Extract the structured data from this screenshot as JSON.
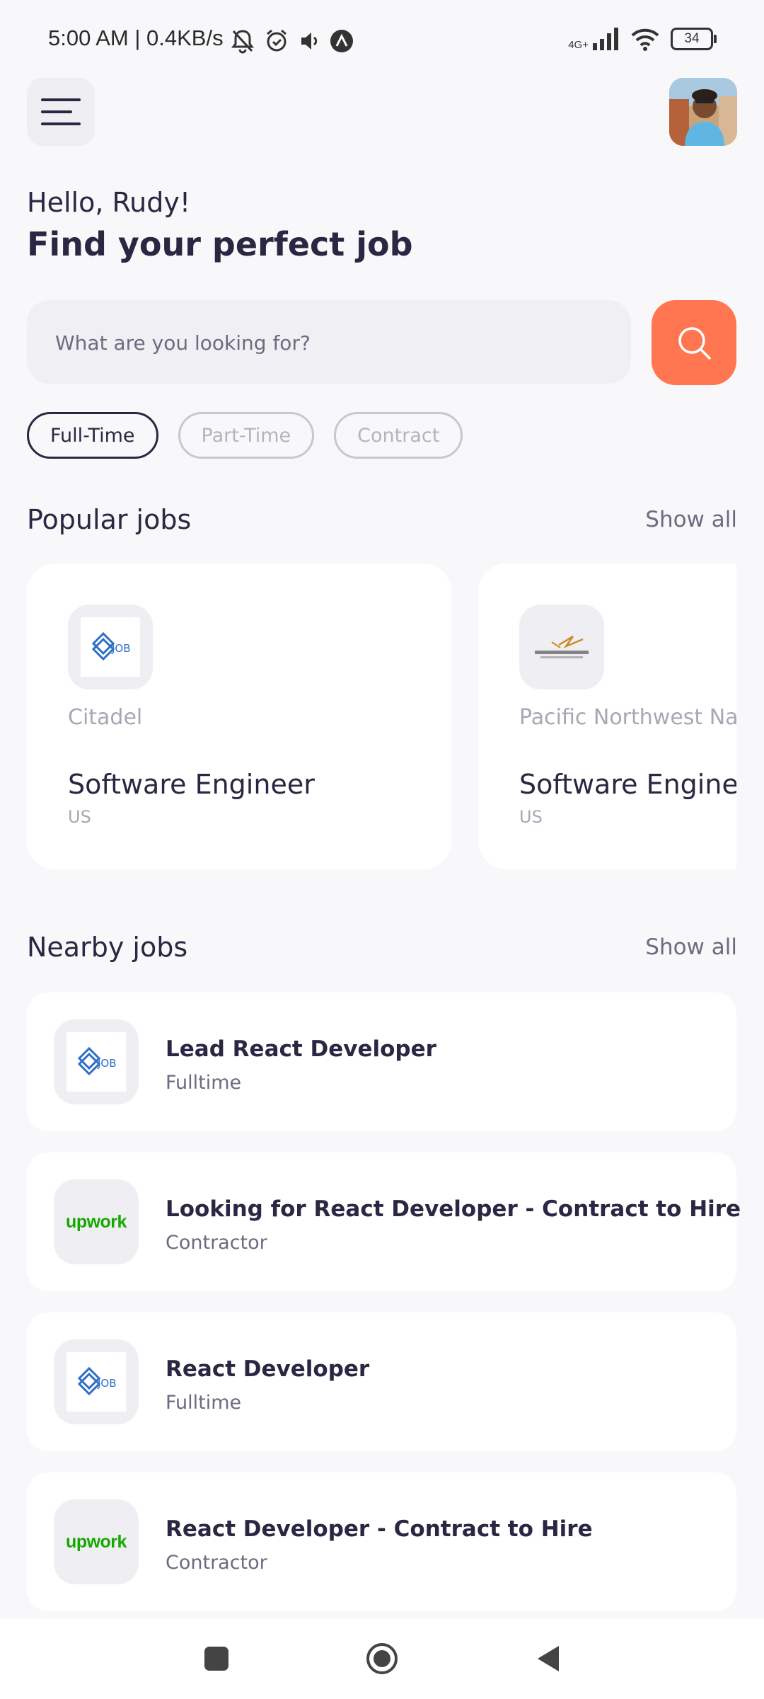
{
  "status_bar": {
    "time_and_speed": "5:00 AM | 0.4KB/s",
    "network": "4G+",
    "battery": "34"
  },
  "header": {
    "greeting": "Hello, Rudy!",
    "title": "Find your perfect job"
  },
  "search": {
    "placeholder": "What are you looking for?"
  },
  "filters": [
    "Full-Time",
    "Part-Time",
    "Contract"
  ],
  "popular": {
    "title": "Popular jobs",
    "show_all": "Show all",
    "jobs": [
      {
        "company": "Citadel",
        "title": "Software Engineer",
        "location": "US",
        "logo_icon": "job-logo-icon"
      },
      {
        "company": "Pacific Northwest National Laboratory",
        "title": "Software Engineer",
        "location": "US",
        "logo_icon": "pnnl-logo-icon"
      }
    ]
  },
  "nearby": {
    "title": "Nearby jobs",
    "show_all": "Show all",
    "jobs": [
      {
        "title": "Lead React Developer",
        "type": "Fulltime",
        "logo_icon": "job-logo-icon"
      },
      {
        "title": "Looking for React Developer - Contract to Hire",
        "type": "Contractor",
        "logo": "upwork"
      },
      {
        "title": "React Developer",
        "type": "Fulltime",
        "logo_icon": "job-logo-icon"
      },
      {
        "title": "React Developer - Contract to Hire",
        "type": "Contractor",
        "logo": "upwork"
      }
    ]
  },
  "colors": {
    "accent": "#ff7651",
    "text_dark": "#2b2642",
    "text_muted": "#6e6a80",
    "background": "#f8f8fb",
    "upwork_green": "#14a800"
  }
}
